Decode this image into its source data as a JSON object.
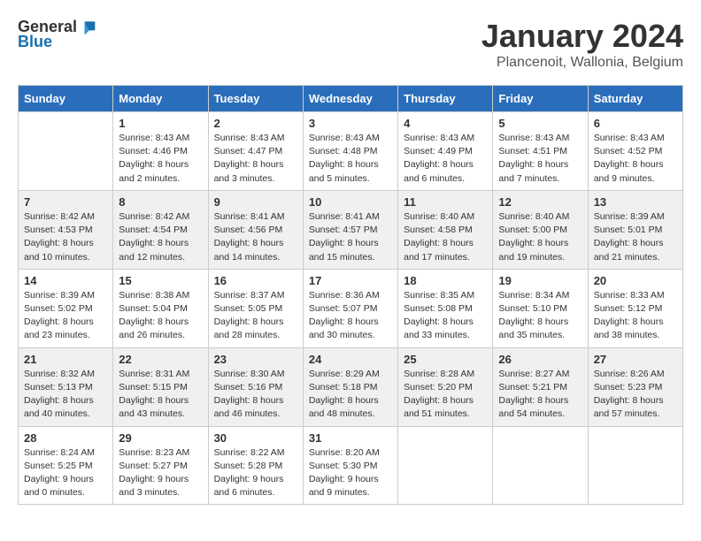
{
  "header": {
    "logo_general": "General",
    "logo_blue": "Blue",
    "month_title": "January 2024",
    "subtitle": "Plancenoit, Wallonia, Belgium"
  },
  "days_of_week": [
    "Sunday",
    "Monday",
    "Tuesday",
    "Wednesday",
    "Thursday",
    "Friday",
    "Saturday"
  ],
  "weeks": [
    [
      {
        "day": "",
        "info": ""
      },
      {
        "day": "1",
        "info": "Sunrise: 8:43 AM\nSunset: 4:46 PM\nDaylight: 8 hours\nand 2 minutes."
      },
      {
        "day": "2",
        "info": "Sunrise: 8:43 AM\nSunset: 4:47 PM\nDaylight: 8 hours\nand 3 minutes."
      },
      {
        "day": "3",
        "info": "Sunrise: 8:43 AM\nSunset: 4:48 PM\nDaylight: 8 hours\nand 5 minutes."
      },
      {
        "day": "4",
        "info": "Sunrise: 8:43 AM\nSunset: 4:49 PM\nDaylight: 8 hours\nand 6 minutes."
      },
      {
        "day": "5",
        "info": "Sunrise: 8:43 AM\nSunset: 4:51 PM\nDaylight: 8 hours\nand 7 minutes."
      },
      {
        "day": "6",
        "info": "Sunrise: 8:43 AM\nSunset: 4:52 PM\nDaylight: 8 hours\nand 9 minutes."
      }
    ],
    [
      {
        "day": "7",
        "info": "Sunrise: 8:42 AM\nSunset: 4:53 PM\nDaylight: 8 hours\nand 10 minutes."
      },
      {
        "day": "8",
        "info": "Sunrise: 8:42 AM\nSunset: 4:54 PM\nDaylight: 8 hours\nand 12 minutes."
      },
      {
        "day": "9",
        "info": "Sunrise: 8:41 AM\nSunset: 4:56 PM\nDaylight: 8 hours\nand 14 minutes."
      },
      {
        "day": "10",
        "info": "Sunrise: 8:41 AM\nSunset: 4:57 PM\nDaylight: 8 hours\nand 15 minutes."
      },
      {
        "day": "11",
        "info": "Sunrise: 8:40 AM\nSunset: 4:58 PM\nDaylight: 8 hours\nand 17 minutes."
      },
      {
        "day": "12",
        "info": "Sunrise: 8:40 AM\nSunset: 5:00 PM\nDaylight: 8 hours\nand 19 minutes."
      },
      {
        "day": "13",
        "info": "Sunrise: 8:39 AM\nSunset: 5:01 PM\nDaylight: 8 hours\nand 21 minutes."
      }
    ],
    [
      {
        "day": "14",
        "info": "Sunrise: 8:39 AM\nSunset: 5:02 PM\nDaylight: 8 hours\nand 23 minutes."
      },
      {
        "day": "15",
        "info": "Sunrise: 8:38 AM\nSunset: 5:04 PM\nDaylight: 8 hours\nand 26 minutes."
      },
      {
        "day": "16",
        "info": "Sunrise: 8:37 AM\nSunset: 5:05 PM\nDaylight: 8 hours\nand 28 minutes."
      },
      {
        "day": "17",
        "info": "Sunrise: 8:36 AM\nSunset: 5:07 PM\nDaylight: 8 hours\nand 30 minutes."
      },
      {
        "day": "18",
        "info": "Sunrise: 8:35 AM\nSunset: 5:08 PM\nDaylight: 8 hours\nand 33 minutes."
      },
      {
        "day": "19",
        "info": "Sunrise: 8:34 AM\nSunset: 5:10 PM\nDaylight: 8 hours\nand 35 minutes."
      },
      {
        "day": "20",
        "info": "Sunrise: 8:33 AM\nSunset: 5:12 PM\nDaylight: 8 hours\nand 38 minutes."
      }
    ],
    [
      {
        "day": "21",
        "info": "Sunrise: 8:32 AM\nSunset: 5:13 PM\nDaylight: 8 hours\nand 40 minutes."
      },
      {
        "day": "22",
        "info": "Sunrise: 8:31 AM\nSunset: 5:15 PM\nDaylight: 8 hours\nand 43 minutes."
      },
      {
        "day": "23",
        "info": "Sunrise: 8:30 AM\nSunset: 5:16 PM\nDaylight: 8 hours\nand 46 minutes."
      },
      {
        "day": "24",
        "info": "Sunrise: 8:29 AM\nSunset: 5:18 PM\nDaylight: 8 hours\nand 48 minutes."
      },
      {
        "day": "25",
        "info": "Sunrise: 8:28 AM\nSunset: 5:20 PM\nDaylight: 8 hours\nand 51 minutes."
      },
      {
        "day": "26",
        "info": "Sunrise: 8:27 AM\nSunset: 5:21 PM\nDaylight: 8 hours\nand 54 minutes."
      },
      {
        "day": "27",
        "info": "Sunrise: 8:26 AM\nSunset: 5:23 PM\nDaylight: 8 hours\nand 57 minutes."
      }
    ],
    [
      {
        "day": "28",
        "info": "Sunrise: 8:24 AM\nSunset: 5:25 PM\nDaylight: 9 hours\nand 0 minutes."
      },
      {
        "day": "29",
        "info": "Sunrise: 8:23 AM\nSunset: 5:27 PM\nDaylight: 9 hours\nand 3 minutes."
      },
      {
        "day": "30",
        "info": "Sunrise: 8:22 AM\nSunset: 5:28 PM\nDaylight: 9 hours\nand 6 minutes."
      },
      {
        "day": "31",
        "info": "Sunrise: 8:20 AM\nSunset: 5:30 PM\nDaylight: 9 hours\nand 9 minutes."
      },
      {
        "day": "",
        "info": ""
      },
      {
        "day": "",
        "info": ""
      },
      {
        "day": "",
        "info": ""
      }
    ]
  ]
}
